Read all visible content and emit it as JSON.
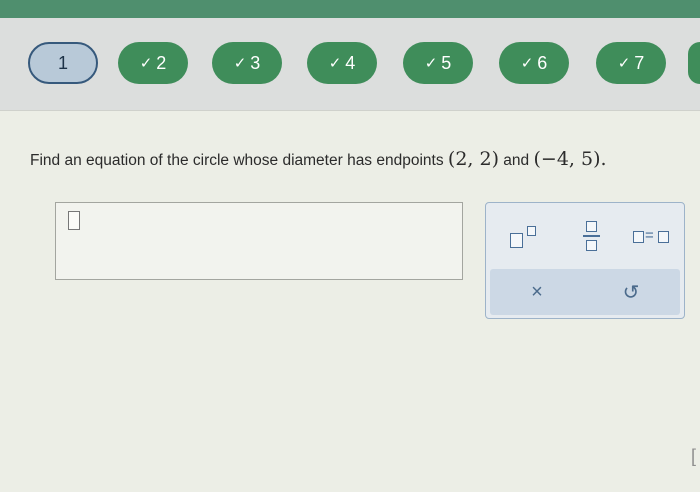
{
  "nav": {
    "questions": [
      {
        "label": "1",
        "state": "current"
      },
      {
        "label": "2",
        "state": "done"
      },
      {
        "label": "3",
        "state": "done"
      },
      {
        "label": "4",
        "state": "done"
      },
      {
        "label": "5",
        "state": "done"
      },
      {
        "label": "6",
        "state": "done"
      },
      {
        "label": "7",
        "state": "done"
      }
    ],
    "check_glyph": "✓"
  },
  "question": {
    "prefix": "Find an equation of the circle whose diameter has endpoints ",
    "point1": "(2, 2)",
    "conj": " and ",
    "point2": "(−4, 5)",
    "suffix": "."
  },
  "answer": {
    "value": ""
  },
  "palette": {
    "tools": [
      "superscript-tool",
      "fraction-tool",
      "equation-tool"
    ],
    "equals_sign": "=",
    "clear_label": "×",
    "undo_label": "↺"
  },
  "colors": {
    "done": "#3f8d5a",
    "current_border": "#36597c",
    "palette_border": "#9db3c9"
  }
}
